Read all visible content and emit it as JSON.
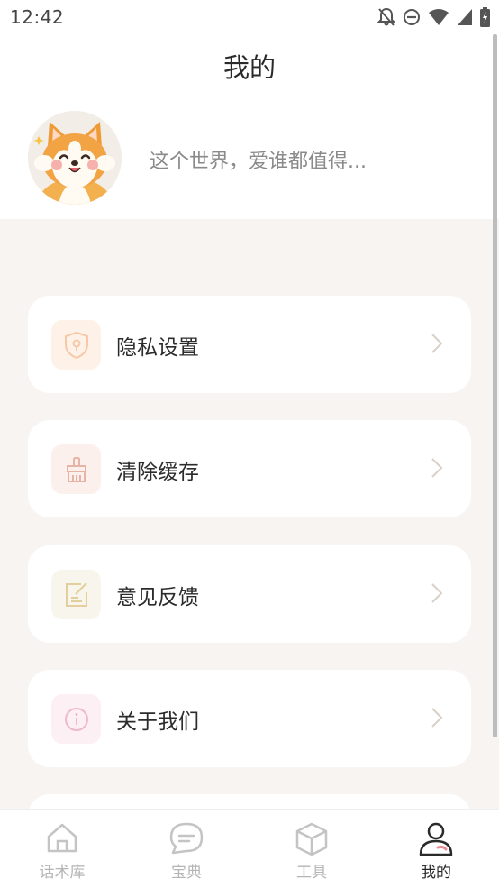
{
  "status_bar": {
    "time": "12:42",
    "icons": [
      "notifications-off-icon",
      "do-not-disturb-icon",
      "wifi-icon",
      "cellular-signal-icon",
      "battery-charging-icon"
    ]
  },
  "header": {
    "title": "我的",
    "bio": "这个世界，爱谁都值得..."
  },
  "menu": [
    {
      "label": "隐私设置",
      "icon": "shield-lock-icon",
      "accent": "#f5c9a8",
      "bg": "#fdf1e8"
    },
    {
      "label": "清除缓存",
      "icon": "broom-icon",
      "accent": "#e6b3a5",
      "bg": "#fbf0ec"
    },
    {
      "label": "意见反馈",
      "icon": "edit-note-icon",
      "accent": "#e3cf9e",
      "bg": "#f8f6ec"
    },
    {
      "label": "关于我们",
      "icon": "info-icon",
      "accent": "#eeb9c8",
      "bg": "#fcf0f4"
    }
  ],
  "tabbar": {
    "tabs": [
      {
        "label": "话术库",
        "icon": "home-icon"
      },
      {
        "label": "宝典",
        "icon": "chat-bubble-icon"
      },
      {
        "label": "工具",
        "icon": "cube-icon"
      },
      {
        "label": "我的",
        "icon": "user-icon"
      }
    ],
    "active_index": 3
  },
  "colors": {
    "page_bg": "#f7f4f1",
    "card_bg": "#ffffff",
    "chevron": "#d9d0c8",
    "inactive_tab": "#b5b5b5",
    "active_tab": "#2a2a2a",
    "active_accent": "#e88b96"
  }
}
